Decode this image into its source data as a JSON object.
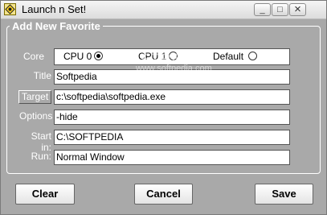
{
  "window": {
    "title": "Launch n Set!",
    "minimize_glyph": "_",
    "maximize_glyph": "□",
    "close_glyph": "×"
  },
  "group": {
    "title": "Add New Favorite"
  },
  "core": {
    "label": "Core",
    "options": [
      {
        "label": "CPU 0",
        "checked": true
      },
      {
        "label": "CPU 1",
        "checked": false
      },
      {
        "label": "Default",
        "checked": false
      }
    ]
  },
  "fields": {
    "title": {
      "label": "Title",
      "value": "Softpedia"
    },
    "target": {
      "label": "Target",
      "value": "c:\\softpedia\\softpedia.exe"
    },
    "options": {
      "label": "Options",
      "value": "-hide"
    },
    "start_in": {
      "label": "Start in:",
      "value": "C:\\SOFTPEDIA"
    },
    "run": {
      "label": "Run:",
      "value": "Normal Window"
    }
  },
  "watermark": {
    "text": "SOFTPEDIA",
    "url": "www.softpedia.com"
  },
  "buttons": {
    "clear": "Clear",
    "cancel": "Cancel",
    "save": "Save"
  },
  "colors": {
    "window_bg": "#a9a9a9",
    "label_text": "#ffffff"
  },
  "icons": {
    "app": "diamond-launch-icon"
  }
}
